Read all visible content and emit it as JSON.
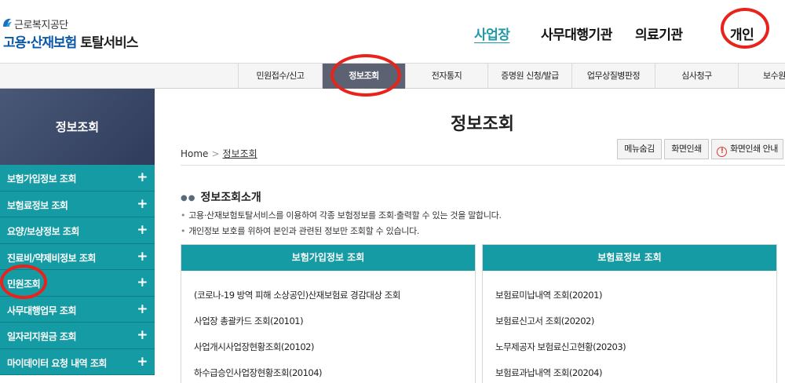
{
  "header": {
    "org_name": "근로복지공단",
    "service_name_blue": "고용·산재보험",
    "service_name_dark": "토탈서비스",
    "nav": [
      {
        "label": "사업장",
        "active": true
      },
      {
        "label": "사무대행기관",
        "active": false
      },
      {
        "label": "의료기관",
        "active": false
      },
      {
        "label": "개인",
        "active": false
      }
    ]
  },
  "gnb": [
    {
      "label": "민원접수/신고",
      "active": false
    },
    {
      "label": "정보조회",
      "active": true
    },
    {
      "label": "전자통지",
      "active": false
    },
    {
      "label": "증명원 신청/발급",
      "active": false
    },
    {
      "label": "업무상질병판정",
      "active": false
    },
    {
      "label": "심사청구",
      "active": false
    },
    {
      "label": "보수원클릭",
      "active": false
    }
  ],
  "sidebar": {
    "title": "정보조회",
    "items": [
      {
        "label": "보험가입정보 조회"
      },
      {
        "label": "보험료정보 조회"
      },
      {
        "label": "요양/보상정보 조회"
      },
      {
        "label": "진료비/약제비정보 조회"
      },
      {
        "label": "민원조회"
      },
      {
        "label": "사무대행업무 조회"
      },
      {
        "label": "일자리지원금 조회"
      },
      {
        "label": "마이데이터 요청 내역 조회"
      }
    ],
    "expand_symbol": "+"
  },
  "main": {
    "title": "정보조회",
    "breadcrumb": {
      "home": "Home",
      "separator": ">",
      "current": "정보조회"
    },
    "buttons": {
      "hide_menu": "메뉴숨김",
      "print": "화면인쇄",
      "print_guide": "화면인쇄 안내"
    },
    "intro": {
      "title": "정보조회소개",
      "lines": [
        "고용·산재보험토탈서비스를 이용하여 각종 보험정보를 조회·출력할 수 있는 것을 말합니다.",
        "개인정보 보호를 위하여 본인과 관련된 정보만 조회할 수 있습니다."
      ]
    },
    "cards": [
      {
        "title": "보험가입정보 조회",
        "items": [
          "(코로나-19 방역 피해 소상공인)산재보험료 경감대상 조회",
          "사업장 총괄카드 조회(20101)",
          "사업개시사업장현황조회(20102)",
          "하수급승인사업장현황조회(20104)"
        ]
      },
      {
        "title": "보험료정보 조회",
        "items": [
          "보험료미납내역 조회(20201)",
          "보험료신고서 조회(20202)",
          "노무제공자 보험료신고현황(20203)",
          "보험료과납내역 조회(20204)"
        ]
      }
    ]
  },
  "colors": {
    "accent_teal": "#149ba4",
    "gnb_active": "#5c6272",
    "brand_blue": "#0b5aa8",
    "annotation_red": "#e8231b"
  }
}
